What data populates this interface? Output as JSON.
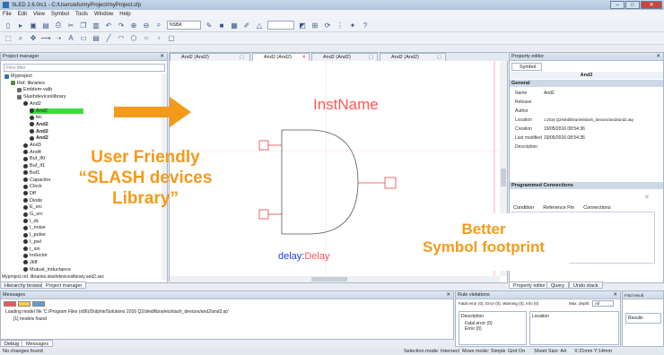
{
  "window": {
    "title": "SLED 2.6.0rc1 - C:/Users/efu/myProject/myProject.sfp",
    "min": "–",
    "max": "□",
    "close": "✕"
  },
  "menu": [
    "File",
    "Edit",
    "View",
    "Symbol",
    "Tools",
    "Window",
    "Help"
  ],
  "toolbar": {
    "font_select": "NSBA"
  },
  "project_manager": {
    "title": "Project manager",
    "filter_placeholder": "Files filter",
    "tree": [
      {
        "label": "Myproject",
        "indent": 0
      },
      {
        "label": "Ref. libraries",
        "indent": 1
      },
      {
        "label": "Emblem-valb",
        "indent": 2
      },
      {
        "label": "Slashdeviceslibrary",
        "indent": 2
      },
      {
        "label": "And2",
        "indent": 3
      },
      {
        "label": "And2",
        "indent": 4
      },
      {
        "label": "lec",
        "indent": 4
      },
      {
        "label": "And2",
        "indent": 4
      },
      {
        "label": "And2",
        "indent": 4
      },
      {
        "label": "And2",
        "indent": 4
      },
      {
        "label": "And3",
        "indent": 3
      },
      {
        "label": "And4",
        "indent": 3
      },
      {
        "label": "Buf_if0",
        "indent": 3
      },
      {
        "label": "Buf_if1",
        "indent": 3
      },
      {
        "label": "Buf1",
        "indent": 3
      },
      {
        "label": "Capacitor",
        "indent": 3
      },
      {
        "label": "Clock",
        "indent": 3
      },
      {
        "label": "Dff",
        "indent": 3
      },
      {
        "label": "Diode",
        "indent": 3
      },
      {
        "label": "E_src",
        "indent": 3
      },
      {
        "label": "G_src",
        "indent": 3
      },
      {
        "label": "I_dc",
        "indent": 3
      },
      {
        "label": "I_noise",
        "indent": 3
      },
      {
        "label": "I_pulse",
        "indent": 3
      },
      {
        "label": "I_pwl",
        "indent": 3
      },
      {
        "label": "I_sin",
        "indent": 3
      },
      {
        "label": "Inductor",
        "indent": 3
      },
      {
        "label": "Jkff",
        "indent": 3
      },
      {
        "label": "Mutual_inductance",
        "indent": 3
      }
    ],
    "status_path": "Myproject.ref. libraries.slashdeviceslibrary.and2.sec",
    "tabs": [
      "Hierarchy browser",
      "Project manager"
    ]
  },
  "doc_tabs": [
    "And2 (And2)",
    "And2 (And2)",
    "And2 (And2)",
    "And2 (And2)"
  ],
  "canvas": {
    "inst_name": "InstName",
    "delay_prefix": "delay:",
    "delay_value": "Delay"
  },
  "callouts": {
    "friendly_line1": "User Friendly",
    "friendly_line2": "“SLASH devices",
    "friendly_line3": "Library”",
    "footprint_line1": "Better",
    "footprint_line2": "Symbol footprint"
  },
  "property_editor": {
    "title": "Property editor",
    "tab": "Symbol",
    "header": "And2",
    "section": "General",
    "rows": [
      {
        "k": "Name",
        "v": "And2"
      },
      {
        "k": "Release",
        "v": ""
      },
      {
        "k": "Author",
        "v": ""
      },
      {
        "k": "Location",
        "v": "c:2016 Q2/sled/libraries/slash_devices/and2/and2.asy"
      },
      {
        "k": "Creation",
        "v": "19/05/2016 08:54:36"
      },
      {
        "k": "Last modified",
        "v": "19/05/2016 08:54:36"
      },
      {
        "k": "Description",
        "v": ""
      }
    ],
    "connections_title": "Programmed Connections",
    "conn_cols": [
      "Condition",
      "Reference Pin",
      "Connections"
    ],
    "bottom_tabs": [
      "Property editor",
      "Query",
      "Undo stack"
    ]
  },
  "messages": {
    "title": "Messages",
    "line1": "Loading model file 'C:/Program Files (x86)/Dolphin/Solutions 2016 Q2/sled/libraries/slash_devices/and2/and2.sp'",
    "line2": "[1] models found",
    "tabs": [
      "Debug",
      "Messages"
    ]
  },
  "rule_violations": {
    "title": "Rule violations",
    "summary": "Fatal error (0), Error (0), Warning (0), Info (0)",
    "depth_label": "Max. depth:",
    "depth_value": "All",
    "col_description": "Description",
    "col_location": "Location",
    "item1": "Fatal error (0)",
    "item2": "Error (0)"
  },
  "find_result": {
    "title": "Find result",
    "results_label": "Results"
  },
  "status": {
    "left": "No changes found",
    "selection": "Selection mode: Intersect",
    "move": "Move mode: Simple",
    "grid": "Grid On",
    "sheet": "Sheet Size: A4",
    "coords": "X:21mm Y:14mm"
  },
  "colors": {
    "accent_orange": "#f39a1a",
    "canvas_text_red": "#ff5555",
    "delay_blue": "#1b3fd8"
  }
}
